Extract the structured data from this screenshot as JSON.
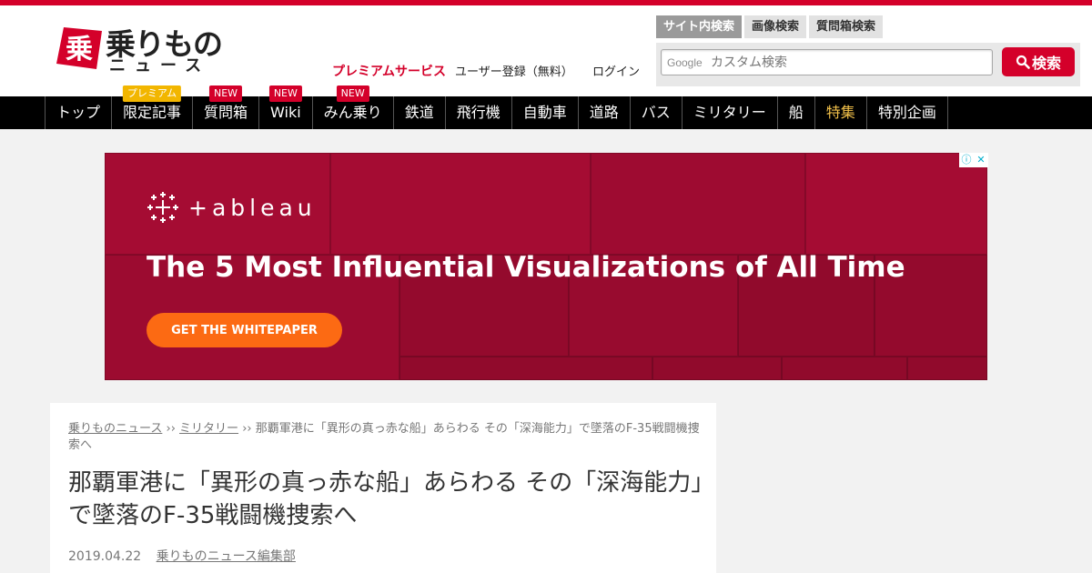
{
  "header": {
    "logo_text": "乗りもの",
    "logo_sub": "ニュース",
    "logo_mark_char": "乗",
    "premium_link": "プレミアムサービス",
    "register_link": "ユーザー登録（無料）",
    "login_link": "ログイン"
  },
  "search": {
    "tabs": [
      "サイト内検索",
      "画像検索",
      "質問箱検索"
    ],
    "active_tab": "サイト内検索",
    "google_label": "Google",
    "placeholder": "カスタム検索",
    "button_label": "検索"
  },
  "nav": {
    "items": [
      {
        "label": "トップ",
        "badge": ""
      },
      {
        "label": "限定記事",
        "badge": "プレミアム"
      },
      {
        "label": "質問箱",
        "badge": "NEW"
      },
      {
        "label": "Wiki",
        "badge": "NEW"
      },
      {
        "label": "みん乗り",
        "badge": "NEW"
      },
      {
        "label": "鉄道",
        "badge": ""
      },
      {
        "label": "飛行機",
        "badge": ""
      },
      {
        "label": "自動車",
        "badge": ""
      },
      {
        "label": "道路",
        "badge": ""
      },
      {
        "label": "バス",
        "badge": ""
      },
      {
        "label": "ミリタリー",
        "badge": ""
      },
      {
        "label": "船",
        "badge": ""
      },
      {
        "label": "特集",
        "badge": ""
      },
      {
        "label": "特別企画",
        "badge": ""
      }
    ]
  },
  "ad": {
    "brand": "+ableau",
    "headline": "The 5 Most Influential Visualizations of All Time",
    "cta": "GET THE WHITEPAPER",
    "info_icon": "ⓘ",
    "close_icon": "✕"
  },
  "article": {
    "breadcrumb": {
      "home": "乗りものニュース",
      "category": "ミリタリー",
      "sep": "››",
      "current": "那覇軍港に「異形の真っ赤な船」あらわる その「深海能力」で墜落のF-35戦闘機捜索へ"
    },
    "title": "那覇軍港に「異形の真っ赤な船」あらわる その「深海能力」で墜落のF-35戦闘機捜索へ",
    "date": "2019.04.22",
    "author": "乗りものニュース編集部"
  },
  "colors": {
    "brand_red": "#d4002a",
    "ad_bg": "#a50c33",
    "cta_orange": "#fc6a13",
    "premium_gold": "#f2b600"
  }
}
